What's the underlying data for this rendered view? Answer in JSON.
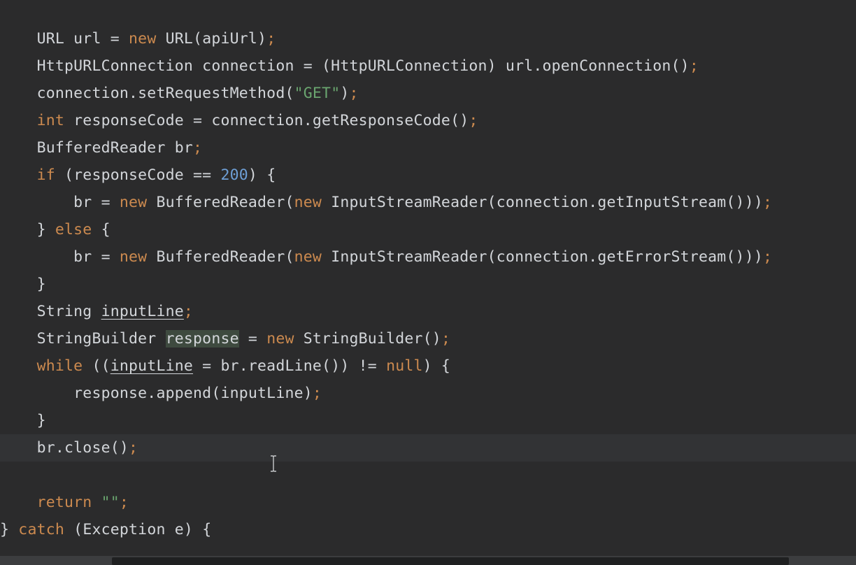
{
  "editor": {
    "theme_colors": {
      "background": "#2b2b2c",
      "current_line": "#323335",
      "default_text": "#d3d6da",
      "keyword": "#cc8a4f",
      "number": "#6e9fd6",
      "string": "#6aa56f",
      "highlight": "#3e4a3f"
    },
    "lines": [
      {
        "tokens": [
          [
            "",
            "    URL url = "
          ],
          [
            "kw",
            "new"
          ],
          [
            "",
            " URL(apiUrl)"
          ],
          [
            "punct",
            ";"
          ]
        ]
      },
      {
        "tokens": [
          [
            "",
            "    HttpURLConnection connection = (HttpURLConnection) url.openConnection()"
          ],
          [
            "punct",
            ";"
          ]
        ]
      },
      {
        "tokens": [
          [
            "",
            "    connection.setRequestMethod("
          ],
          [
            "str",
            "\"GET\""
          ],
          [
            "",
            ")"
          ],
          [
            "punct",
            ";"
          ]
        ]
      },
      {
        "tokens": [
          [
            "kw",
            "    int"
          ],
          [
            "",
            " responseCode = connection.getResponseCode()"
          ],
          [
            "punct",
            ";"
          ]
        ]
      },
      {
        "tokens": [
          [
            "",
            "    BufferedReader br"
          ],
          [
            "punct",
            ";"
          ]
        ]
      },
      {
        "tokens": [
          [
            "kw",
            "    if"
          ],
          [
            "",
            " (responseCode == "
          ],
          [
            "num",
            "200"
          ],
          [
            "",
            ") {"
          ]
        ]
      },
      {
        "tokens": [
          [
            "",
            "        br = "
          ],
          [
            "kw",
            "new"
          ],
          [
            "",
            " BufferedReader("
          ],
          [
            "kw",
            "new"
          ],
          [
            "",
            " InputStreamReader(connection.getInputStream()))"
          ],
          [
            "punct",
            ";"
          ]
        ]
      },
      {
        "tokens": [
          [
            "",
            "    } "
          ],
          [
            "kw",
            "else"
          ],
          [
            "",
            " {"
          ]
        ]
      },
      {
        "tokens": [
          [
            "",
            "        br = "
          ],
          [
            "kw",
            "new"
          ],
          [
            "",
            " BufferedReader("
          ],
          [
            "kw",
            "new"
          ],
          [
            "",
            " InputStreamReader(connection.getErrorStream()))"
          ],
          [
            "punct",
            ";"
          ]
        ]
      },
      {
        "tokens": [
          [
            "",
            "    }"
          ]
        ]
      },
      {
        "tokens": [
          [
            "",
            "    String "
          ],
          [
            "field",
            "inputLine"
          ],
          [
            "punct",
            ";"
          ]
        ]
      },
      {
        "tokens": [
          [
            "",
            "    StringBuilder "
          ],
          [
            "hl",
            "response"
          ],
          [
            "",
            " = "
          ],
          [
            "kw",
            "new"
          ],
          [
            "",
            " StringBuilder()"
          ],
          [
            "punct",
            ";"
          ]
        ]
      },
      {
        "tokens": [
          [
            "kw",
            "    while"
          ],
          [
            "",
            " (("
          ],
          [
            "field",
            "inputLine"
          ],
          [
            "",
            " = br.readLine()) != "
          ],
          [
            "kw",
            "null"
          ],
          [
            "",
            ") {"
          ]
        ]
      },
      {
        "tokens": [
          [
            "",
            "        response.append(inputLine)"
          ],
          [
            "punct",
            ";"
          ]
        ]
      },
      {
        "tokens": [
          [
            "",
            "    }"
          ]
        ]
      },
      {
        "tokens": [
          [
            "",
            "    br.close()"
          ],
          [
            "punct",
            ";"
          ]
        ],
        "current": true
      },
      {
        "tokens": []
      },
      {
        "tokens": [
          [
            "kw",
            "    return"
          ],
          [
            "",
            " "
          ],
          [
            "str",
            "\"\""
          ],
          [
            "punct",
            ";"
          ]
        ]
      },
      {
        "tokens": [
          [
            "",
            "} "
          ],
          [
            "kw",
            "catch"
          ],
          [
            "",
            " (Exception e) {"
          ]
        ]
      }
    ],
    "cursor_icon": "text-cursor-icon",
    "scroll": {
      "horizontal_thumb_fraction": 0.79
    }
  }
}
